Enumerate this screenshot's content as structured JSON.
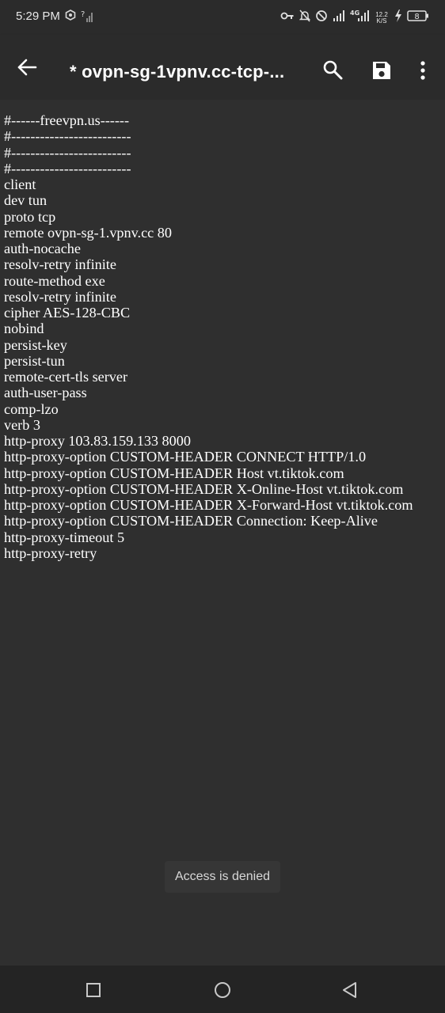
{
  "status_bar": {
    "time": "5:29 PM",
    "network_speed_top": "12.2",
    "network_speed_bottom": "K/S",
    "battery_level": "8",
    "signal_type": "4G",
    "icons": [
      "hexagon-app-icon",
      "no-signal-icon",
      "vpn-key-icon",
      "bell-off-icon",
      "do-not-disturb-icon",
      "signal-icon",
      "4g-signal-icon",
      "charging-icon",
      "battery-icon"
    ]
  },
  "app_bar": {
    "title": "* ovpn-sg-1vpnv.cc-tcp-...",
    "back_icon": "arrow-back-icon",
    "search_icon": "search-icon",
    "save_icon": "save-icon",
    "more_icon": "more-vert-icon"
  },
  "editor": {
    "lines": [
      "#------freevpn.us------",
      "#-------------------------",
      "#-------------------------",
      "#-------------------------",
      "client",
      "dev tun",
      "proto tcp",
      "remote ovpn-sg-1.vpnv.cc 80",
      "auth-nocache",
      "resolv-retry infinite",
      "route-method exe",
      "resolv-retry infinite",
      "cipher AES-128-CBC",
      "nobind",
      "persist-key",
      "persist-tun",
      "remote-cert-tls server",
      "auth-user-pass",
      "comp-lzo",
      "verb 3",
      "http-proxy 103.83.159.133 8000",
      "http-proxy-option CUSTOM-HEADER CONNECT HTTP/1.0",
      "http-proxy-option CUSTOM-HEADER Host vt.tiktok.com",
      "http-proxy-option CUSTOM-HEADER X-Online-Host vt.tiktok.com",
      "http-proxy-option CUSTOM-HEADER X-Forward-Host vt.tiktok.com",
      "http-proxy-option CUSTOM-HEADER Connection: Keep-Alive",
      "http-proxy-timeout 5",
      "http-proxy-retry"
    ]
  },
  "toast": {
    "message": "Access is denied"
  },
  "nav_bar": {
    "recents_icon": "square-recents-icon",
    "home_icon": "circle-home-icon",
    "back_icon": "triangle-back-icon"
  },
  "colors": {
    "background": "#2f2f2f",
    "app_bar": "#2b2b2b",
    "nav_bar": "#242424",
    "text": "#ffffff",
    "toast_bg": "#363636"
  }
}
